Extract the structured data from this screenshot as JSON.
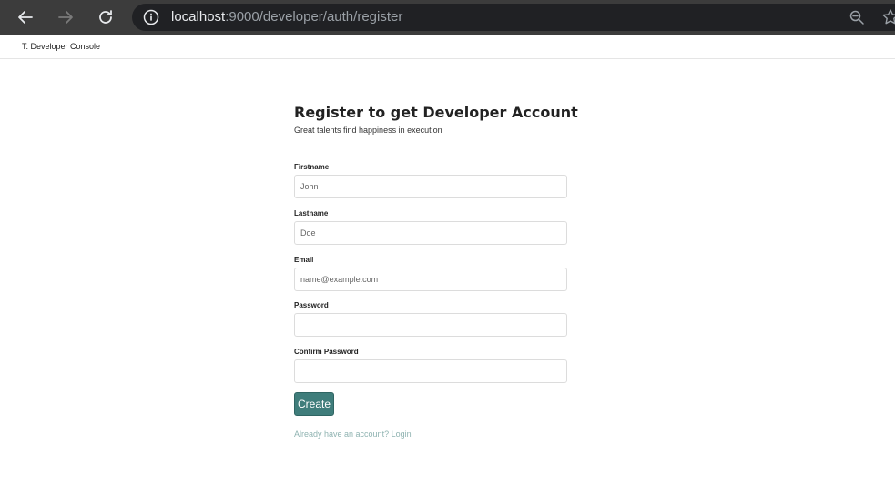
{
  "browser": {
    "url_host": "localhost",
    "url_path": ":9000/developer/auth/register"
  },
  "navbar": {
    "brand": "T. Developer Console"
  },
  "form": {
    "title": "Register to get Developer Account",
    "subtitle": "Great talents find happiness in execution",
    "fields": [
      {
        "label": "Firstname",
        "placeholder": "John",
        "value": ""
      },
      {
        "label": "Lastname",
        "placeholder": "Doe",
        "value": ""
      },
      {
        "label": "Email",
        "placeholder": "name@example.com",
        "value": ""
      },
      {
        "label": "Password",
        "placeholder": "",
        "value": ""
      },
      {
        "label": "Confirm Password",
        "placeholder": "",
        "value": ""
      }
    ],
    "submit_label": "Create",
    "login_link": "Already have an account? Login"
  },
  "colors": {
    "chrome_bg": "#3c3c3c",
    "omnibox_bg": "#202124",
    "primary_button": "#3f7d7b",
    "link": "#8fb3b1"
  },
  "icons": [
    "back-icon",
    "forward-icon",
    "reload-icon",
    "info-icon",
    "zoom-icon",
    "star-icon"
  ]
}
